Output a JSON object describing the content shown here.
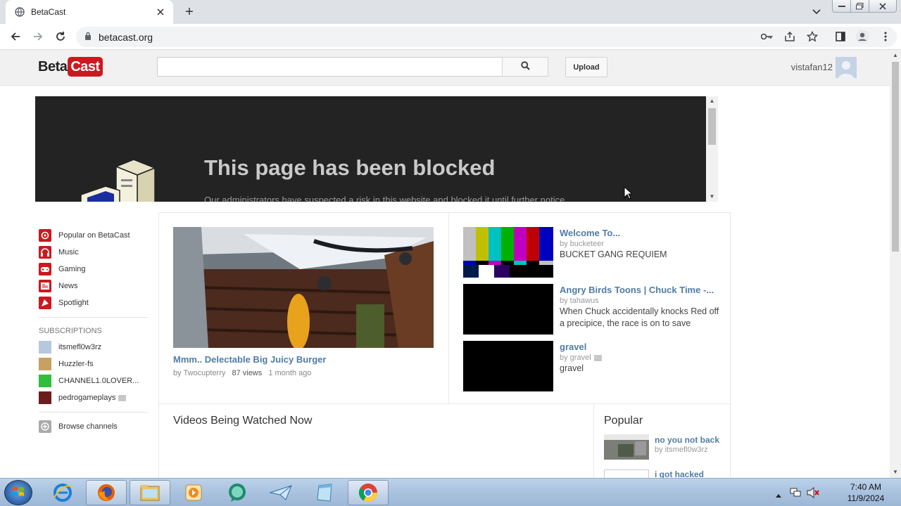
{
  "browser": {
    "tab_title": "BetaCast",
    "url": "betacast.org"
  },
  "site": {
    "logo_beta": "Beta",
    "logo_cast": "Cast",
    "search_placeholder": "",
    "upload_label": "Upload",
    "username": "vistafan12"
  },
  "banner": {
    "title": "This page has been blocked",
    "subtitle": "Our administrators have suspected a risk in this website and blocked it until further notice."
  },
  "guide": {
    "items": [
      {
        "label": "Popular on BetaCast",
        "icon": "popular-icon",
        "color": "#cc181e"
      },
      {
        "label": "Music",
        "icon": "headphones-icon",
        "color": "#cc181e"
      },
      {
        "label": "Gaming",
        "icon": "gamepad-icon",
        "color": "#cc181e"
      },
      {
        "label": "News",
        "icon": "newspaper-icon",
        "color": "#cc181e"
      },
      {
        "label": "Spotlight",
        "icon": "spotlight-icon",
        "color": "#cc181e"
      }
    ],
    "subscriptions_heading": "SUBSCRIPTIONS",
    "subscriptions": [
      {
        "label": "itsmefl0w3rz"
      },
      {
        "label": "Huzzler-fs"
      },
      {
        "label": "CHANNEL1.0LOVER..."
      },
      {
        "label": "pedrogameplays"
      }
    ],
    "browse_label": "Browse channels"
  },
  "featured": {
    "title": "Mmm.. Delectable Big Juicy Burger",
    "by": "by Twocupterry",
    "views": "87 views",
    "ago": "1 month ago"
  },
  "side_videos": [
    {
      "title": "Welcome To...",
      "by": "by bucketeer",
      "desc": "BUCKET GANG REQUIEM"
    },
    {
      "title": "Angry Birds Toons | Chuck Time -...",
      "by": "by tahawus",
      "desc": "When Chuck accidentally knocks Red off a precipice, the race is on to save"
    },
    {
      "title": "gravel",
      "by": "by gravel",
      "desc": "gravel"
    }
  ],
  "watching_now": {
    "heading": "Videos Being Watched Now"
  },
  "popular": {
    "heading": "Popular",
    "items": [
      {
        "title": "no you not back",
        "by": "by itsmefl0w3rz"
      },
      {
        "title": "i got hacked",
        "by": ""
      }
    ]
  },
  "taskbar": {
    "time": "7:40 AM",
    "date": "11/9/2024"
  },
  "colors": {
    "brand_red": "#cc181e",
    "link_blue": "#4f7ca7"
  }
}
